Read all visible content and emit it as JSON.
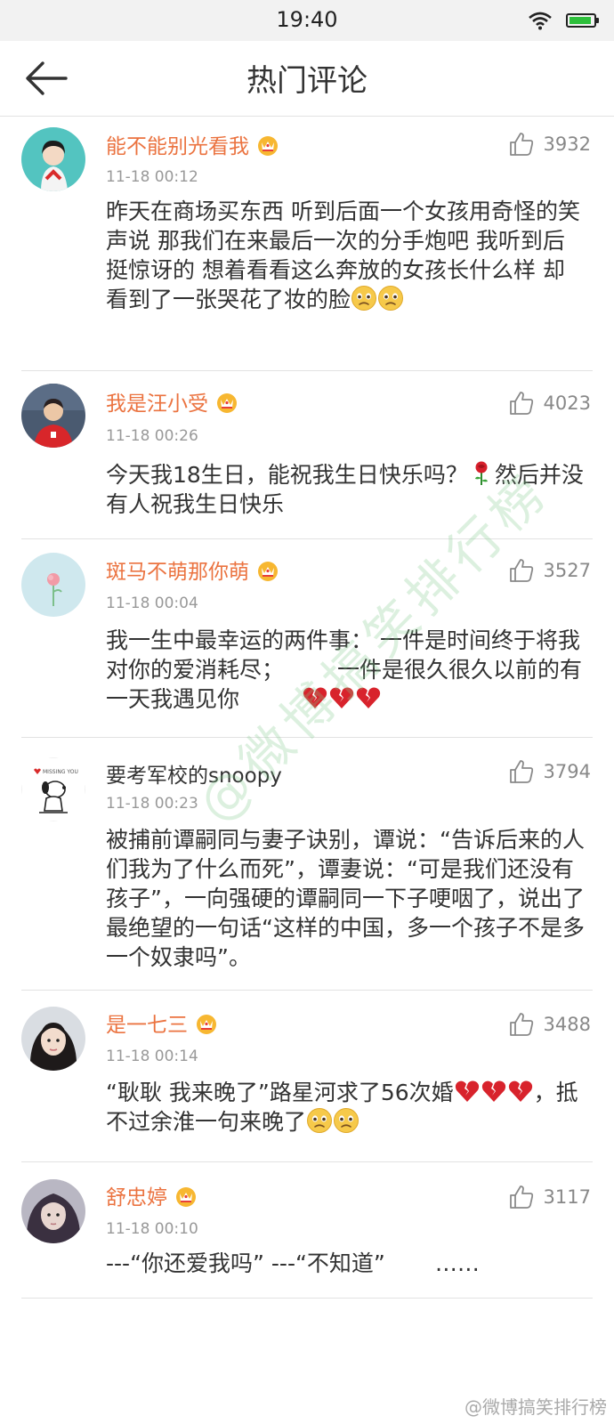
{
  "status_bar": {
    "time": "19:40"
  },
  "header": {
    "title": "热门评论"
  },
  "comments": [
    {
      "username": "能不能别光看我",
      "vip": true,
      "timestamp": "11-18 00:12",
      "likes": "3932",
      "text": "昨天在商场买东西 听到后面一个女孩用奇怪的笑声说 那我们在来最后一次的分手炮吧 我听到后挺惊讶的 想着看看这么奔放的女孩长什么样 却看到了一张哭花了妆的脸",
      "emojis": [
        "sad-face",
        "sad-face"
      ]
    },
    {
      "username": "我是汪小受",
      "vip": true,
      "timestamp": "11-18 00:26",
      "likes": "4023",
      "text_before": "今天我18生日，能祝我生日快乐吗？",
      "text_after": "然后并没有人祝我生日快乐",
      "emojis": [
        "rose"
      ]
    },
    {
      "username": "斑马不萌那你萌",
      "vip": true,
      "timestamp": "11-18 00:04",
      "likes": "3527",
      "line1": "我一生中最幸运的两件事： 一件是时间终于将我对你的爱消耗尽；",
      "line2": "一件是很久很久以前的有一天我遇见你",
      "emojis": [
        "broken-heart",
        "broken-heart",
        "broken-heart"
      ]
    },
    {
      "username": "要考军校的snoopy",
      "vip": false,
      "timestamp": "11-18 00:23",
      "likes": "3794",
      "text": "被捕前谭嗣同与妻子诀别，谭说：“告诉后来的人们我为了什么而死”，谭妻说：“可是我们还没有孩子”，一向强硬的谭嗣同一下子哽咽了，说出了最绝望的一句话“这样的中国，多一个孩子不是多一个奴隶吗”。"
    },
    {
      "username": "是一七三",
      "vip": true,
      "timestamp": "11-18 00:14",
      "likes": "3488",
      "text_before": "“耿耿 我来晚了”路星河求了56次婚",
      "text_after": "，抵不过余淮一句来晚了",
      "emojis_mid": [
        "broken-heart",
        "broken-heart",
        "broken-heart"
      ],
      "emojis_end": [
        "sad-face",
        "sad-face"
      ]
    },
    {
      "username": "舒忠婷",
      "vip": true,
      "timestamp": "11-18 00:10",
      "likes": "3117",
      "text": "---“你还爱我吗” ---“不知道”",
      "tail": "……"
    }
  ],
  "watermark": "@微博搞笑排行榜",
  "corner_watermark": "@微博搞笑排行榜"
}
